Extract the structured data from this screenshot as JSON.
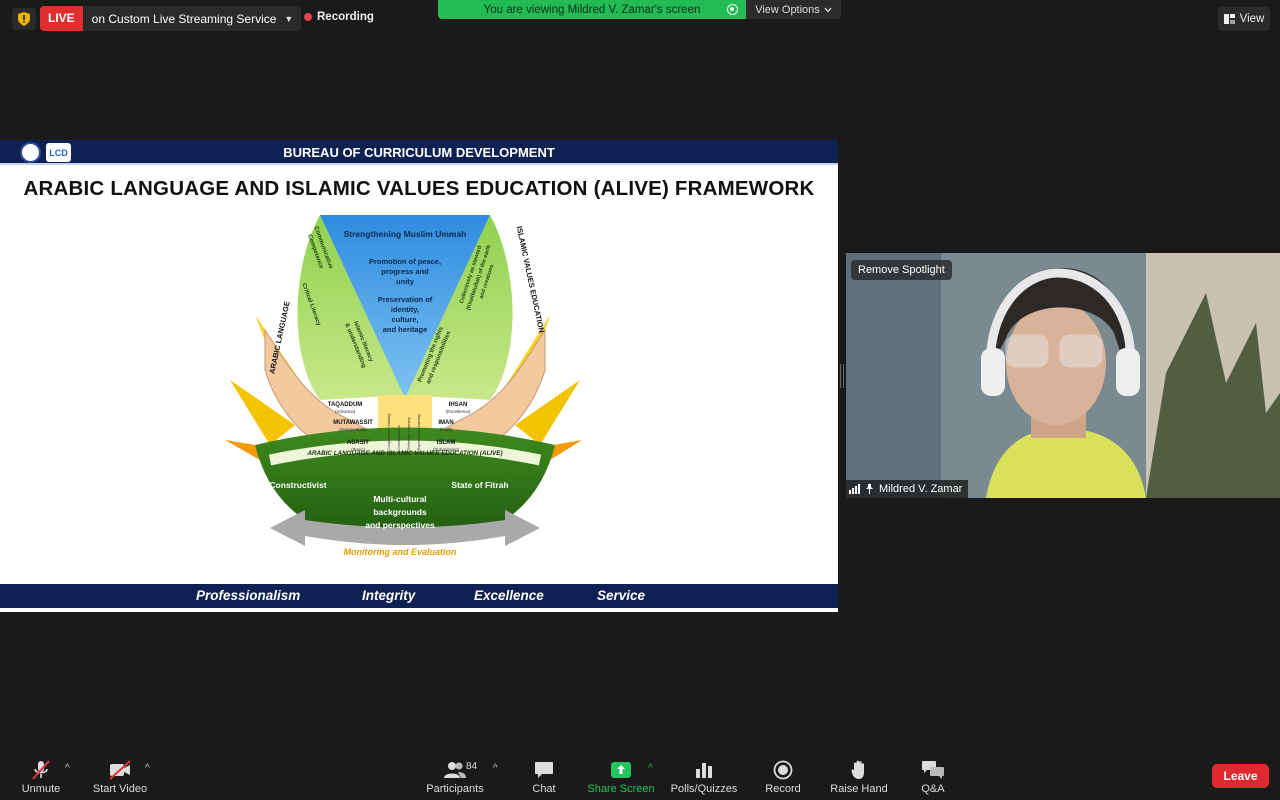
{
  "topbar": {
    "live_label": "LIVE",
    "stream_text": "on Custom Live Streaming Service",
    "recording_label": "Recording",
    "viewing_banner": "You are viewing Mildred V. Zamar's screen",
    "view_options_label": "View Options",
    "view_label": "View"
  },
  "slide": {
    "org": "BUREAU OF CURRICULUM DEVELOPMENT",
    "logo_text": "LCD",
    "title": "ARABIC LANGUAGE AND ISLAMIC VALUES EDUCATION (ALIVE) FRAMEWORK",
    "diagram": {
      "center_top": "Strengthening Muslim Ummah",
      "center_mid": [
        "Promotion of peace,",
        "progress and",
        "unity"
      ],
      "center_low": [
        "Preservation of",
        "identity,",
        "culture,",
        "and heritage"
      ],
      "left_arc": "ARABIC LANGUAGE",
      "right_arc": "ISLAMIC VALUES EDUCATION",
      "left_petal": [
        "Communicative",
        "Competence",
        "Critical Literacy",
        "Islamic literacy",
        "& understanding"
      ],
      "right_petal": [
        "Collectively as steward",
        "(Khalifatullah) of the earth",
        "and creations",
        "Promoting the rights",
        "and responsibilities"
      ],
      "left_levels": [
        {
          "name": "TAQADDUM",
          "sub": "(Advance)"
        },
        {
          "name": "MUTAWASSIT",
          "sub": "(Intermediate)"
        },
        {
          "name": "ASASIY",
          "sub": "(Basic)"
        }
      ],
      "right_levels": [
        {
          "name": "IHSAN",
          "sub": "(Excellence)"
        },
        {
          "name": "IMAN",
          "sub": "(Faith)"
        },
        {
          "name": "ISLAM",
          "sub": "(Submission)"
        }
      ],
      "stem": [
        "Cooperative Learning",
        "Constructivism",
        "Reflective Learning",
        "Experiential Learning"
      ],
      "bowl_arc": "ARABIC LANGUAGE AND ISLAMIC VALUES EDUCATION (ALIVE)",
      "bowl_left": "Constructivist",
      "bowl_right": "State of Fitrah",
      "bowl_center": [
        "Multi-cultural",
        "backgrounds",
        "and perspectives"
      ],
      "arrow_label": "Monitoring and Evaluation"
    },
    "footer": [
      "Professionalism",
      "Integrity",
      "Excellence",
      "Service"
    ]
  },
  "video": {
    "remove_spotlight": "Remove Spotlight",
    "participant_name": "Mildred V. Zamar"
  },
  "toolbar": {
    "unmute": "Unmute",
    "start_video": "Start Video",
    "participants": "Participants",
    "participants_count": "84",
    "chat": "Chat",
    "share_screen": "Share Screen",
    "polls": "Polls/Quizzes",
    "record": "Record",
    "raise_hand": "Raise Hand",
    "qa": "Q&A",
    "leave": "Leave"
  },
  "colors": {
    "live_red": "#e02d2d",
    "banner_green": "#22bb55",
    "slide_navy": "#0f2152",
    "share_green": "#22c55e",
    "leave_red": "#e0282e"
  }
}
